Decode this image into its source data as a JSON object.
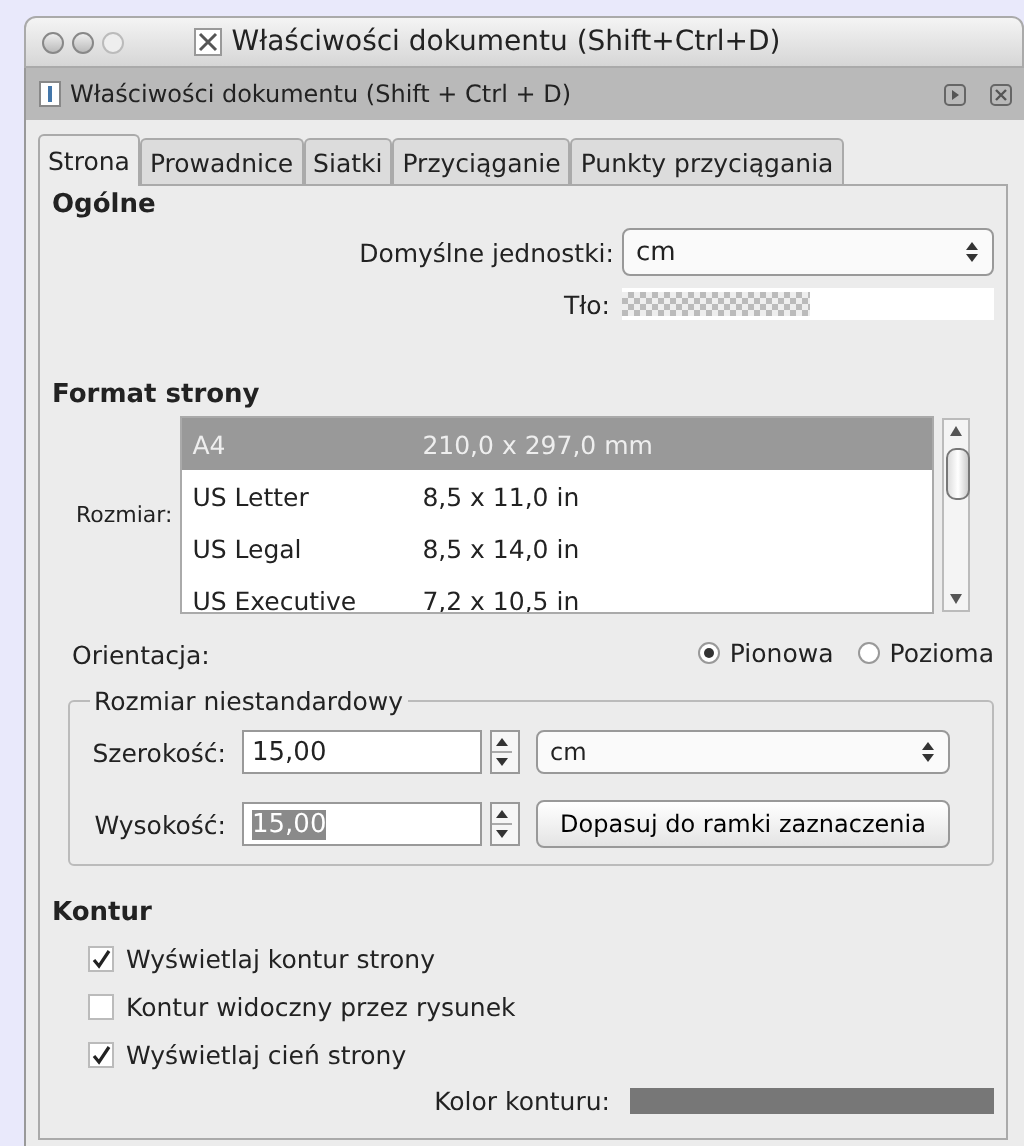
{
  "window": {
    "title": "Właściwości dokumentu (Shift+Ctrl+D)"
  },
  "panel": {
    "title": "Właściwości dokumentu (Shift + Ctrl + D)"
  },
  "tabs": [
    {
      "label": "Strona",
      "selected": true
    },
    {
      "label": "Prowadnice",
      "selected": false
    },
    {
      "label": "Siatki",
      "selected": false
    },
    {
      "label": "Przyciąganie",
      "selected": false
    },
    {
      "label": "Punkty przyciągania",
      "selected": false
    }
  ],
  "general": {
    "heading": "Ogólne",
    "default_units": {
      "label": "Domyślne jednostki:",
      "value": "cm"
    },
    "background": {
      "label": "Tło:"
    }
  },
  "page_format": {
    "heading": "Format strony",
    "size_label": "Rozmiar:",
    "sizes": [
      {
        "name": "A4",
        "dimensions": "210,0 x 297,0 mm",
        "selected": true
      },
      {
        "name": "US Letter",
        "dimensions": "8,5 x 11,0 in",
        "selected": false
      },
      {
        "name": "US Legal",
        "dimensions": "8,5 x 14,0 in",
        "selected": false
      },
      {
        "name": "US Executive",
        "dimensions": "7,2 x 10,5 in",
        "selected": false
      }
    ],
    "orientation_label": "Orientacja:",
    "orientations": [
      {
        "label": "Pionowa",
        "selected": true
      },
      {
        "label": "Pozioma",
        "selected": false
      }
    ],
    "custom_size": {
      "legend": "Rozmiar niestandardowy",
      "width": {
        "label": "Szerokość:",
        "value": "15,00",
        "selected": false
      },
      "height": {
        "label": "Wysokość:",
        "value": "15,00",
        "selected": true
      },
      "units": "cm",
      "fit_button": "Dopasuj do ramki zaznaczenia"
    }
  },
  "border": {
    "heading": "Kontur",
    "options": [
      {
        "label": "Wyświetlaj kontur strony",
        "checked": true
      },
      {
        "label": "Kontur widoczny przez rysunek",
        "checked": false
      },
      {
        "label": "Wyświetlaj cień strony",
        "checked": true
      }
    ],
    "color_label": "Kolor konturu:"
  }
}
